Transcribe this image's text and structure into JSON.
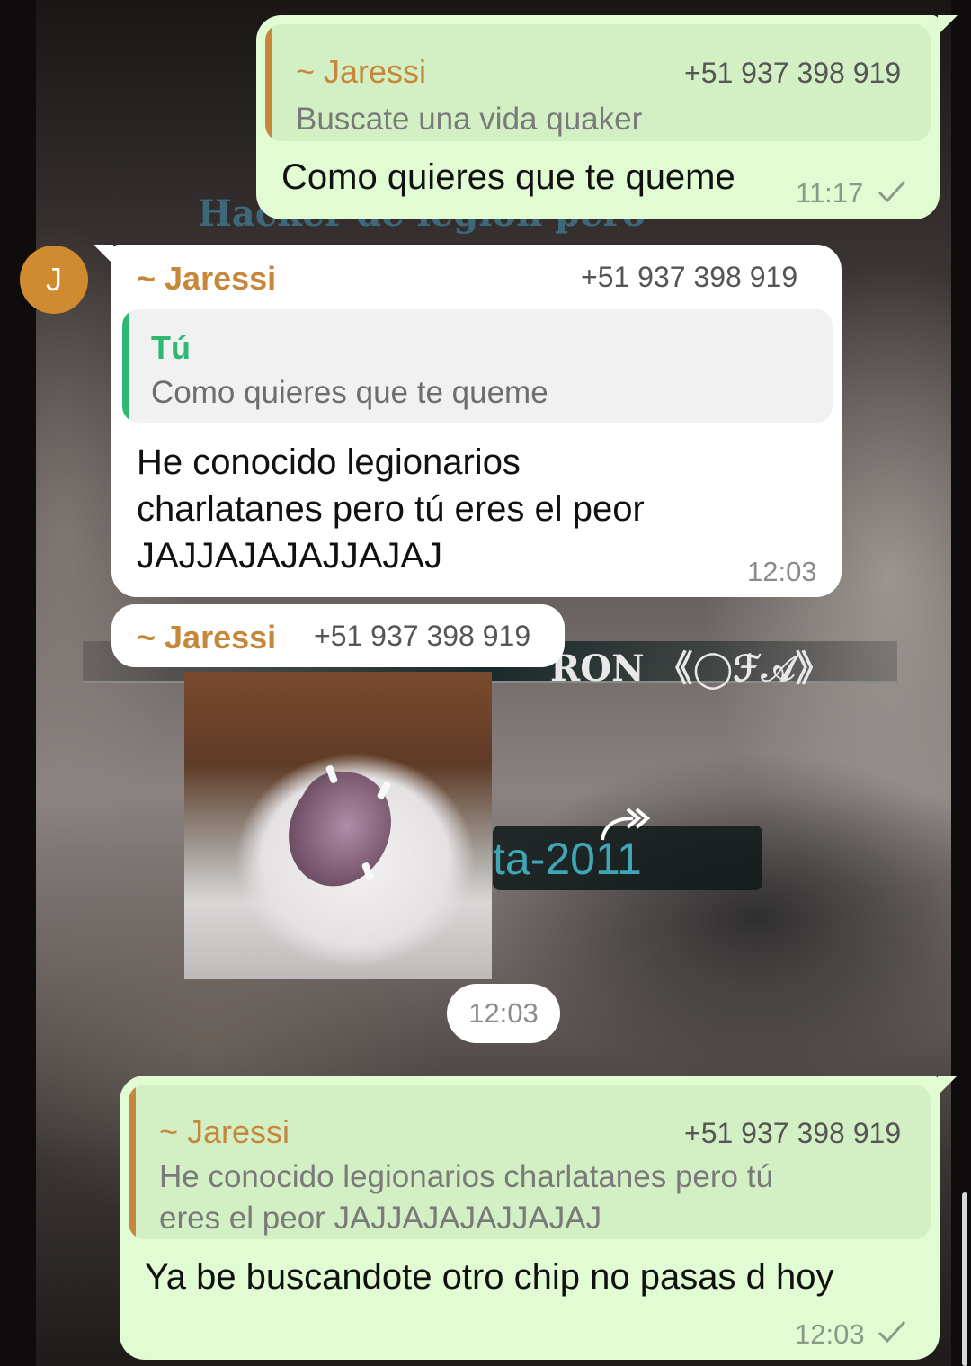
{
  "chat": {
    "contact_initial": "J",
    "messages": [
      {
        "direction": "outgoing",
        "quote_sender": "~ Jaressi",
        "quote_phone": "+51 937 398 919",
        "quote_text": "Buscate una vida quaker",
        "text": "Como quieres que te queme",
        "time": "11:17"
      },
      {
        "direction": "incoming",
        "sender": "~ Jaressi",
        "phone": "+51 937 398 919",
        "quote_sender": "Tú",
        "quote_text": "Como quieres que te queme",
        "text_lines": [
          "He conocido legionarios",
          "charlatanes pero tú eres el peor",
          "JAJJAJAJAJJAJAJ"
        ],
        "time": "12:03"
      },
      {
        "direction": "incoming",
        "sender": "~ Jaressi",
        "phone": "+51 937 398 919",
        "sticker": "screaming-cat-sticker",
        "time": "12:03"
      },
      {
        "direction": "outgoing",
        "quote_sender": "~ Jaressi",
        "quote_phone": "+51 937 398 919",
        "quote_text_lines": [
          "He conocido legionarios charlatanes pero tú",
          "eres el peor JAJJAJAJAJJAJAJ"
        ],
        "text": "Ya be buscandote otro chip no pasas d hoy",
        "time": "12:03"
      }
    ]
  },
  "wallpaper": {
    "text_top": "Hacker de legion pero",
    "banner_text": "RON 《◯ℱ𝒜》",
    "sub_text": "ta-2011"
  },
  "colors": {
    "outgoing_bubble": "#e1fbd3",
    "incoming_bubble": "#ffffff",
    "sender_name": "#c6873a",
    "quote_bar_other": "#c6873a",
    "quote_bar_self": "#2eb873",
    "avatar": "#d08a2f"
  },
  "icons": [
    "check-icon",
    "forward-icon"
  ]
}
